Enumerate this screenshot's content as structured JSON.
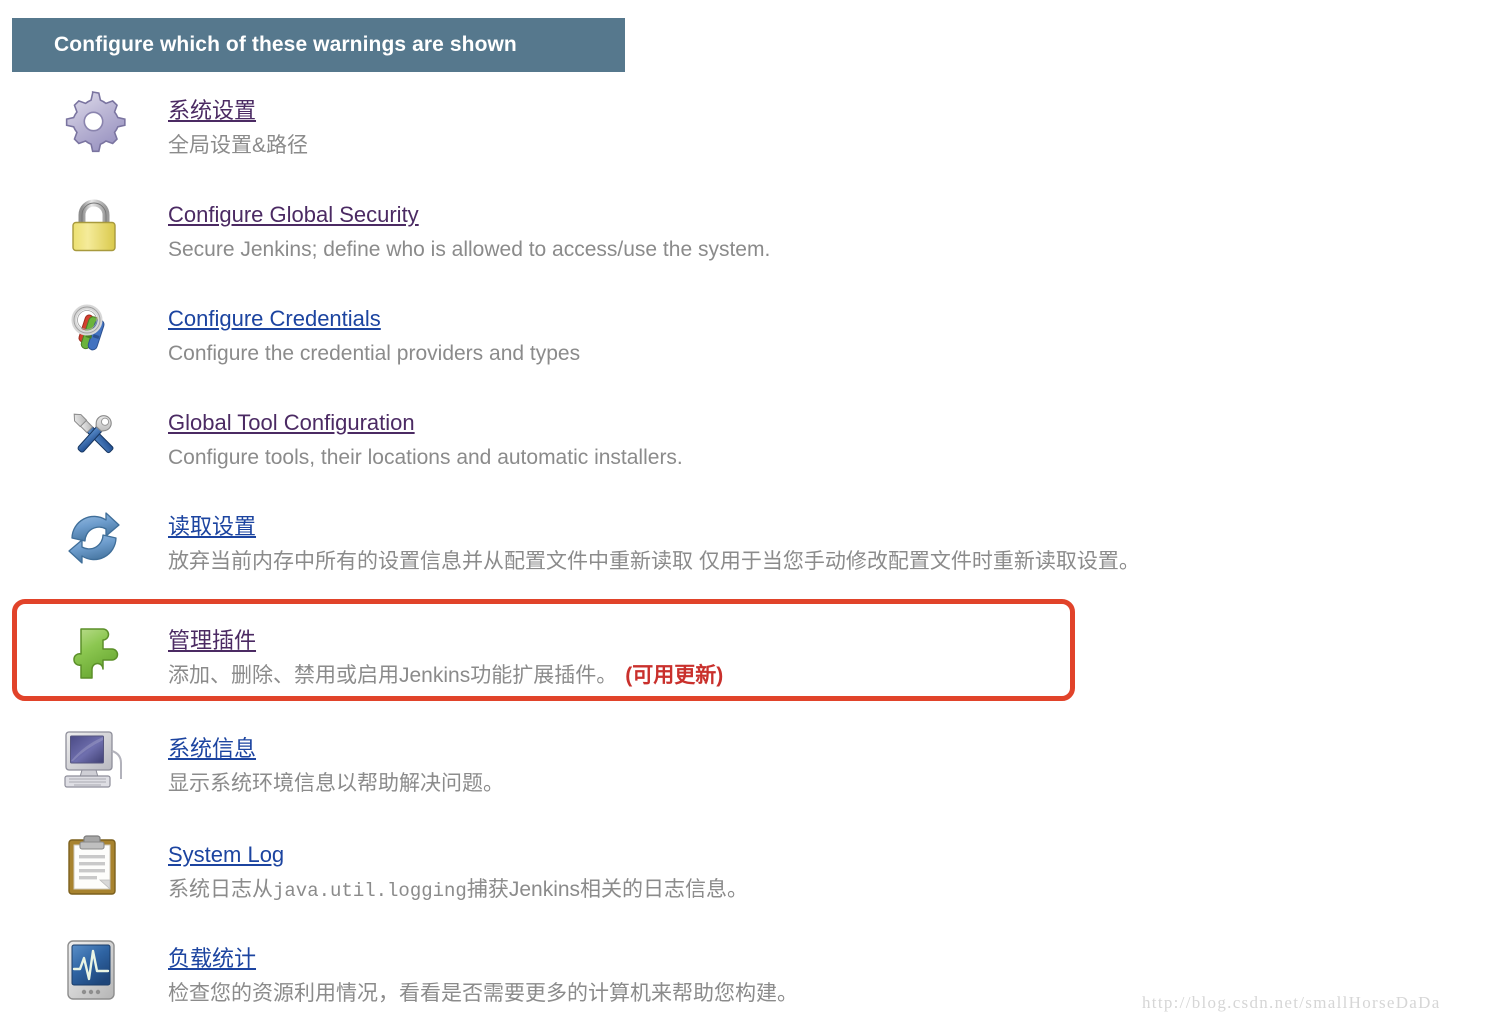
{
  "header": {
    "title": "Configure which of these warnings are shown",
    "bar_color": "#56788d",
    "text_color": "#ffffff"
  },
  "colors": {
    "visited_link": "#4b2a63",
    "unvisited_link": "#1c44a0",
    "description": "#8b8b8b",
    "highlight_border": "#e1432a",
    "update_badge": "#c9302c"
  },
  "items": [
    {
      "icon": "gear-icon",
      "label": "系统设置",
      "link_state": "visited",
      "description": "全局设置&路径",
      "badge": ""
    },
    {
      "icon": "padlock-icon",
      "label": "Configure Global Security",
      "link_state": "visited",
      "description": "Secure Jenkins; define who is allowed to access/use the system.",
      "badge": ""
    },
    {
      "icon": "keys-icon",
      "label": "Configure Credentials",
      "link_state": "unvisited",
      "description": "Configure the credential providers and types",
      "badge": ""
    },
    {
      "icon": "wrench-screwdriver-icon",
      "label": "Global Tool Configuration",
      "link_state": "visited",
      "description": "Configure tools, their locations and automatic installers.",
      "badge": ""
    },
    {
      "icon": "refresh-arrows-icon",
      "label": "读取设置",
      "link_state": "unvisited",
      "description": "放弃当前内存中所有的设置信息并从配置文件中重新读取 仅用于当您手动修改配置文件时重新读取设置。",
      "badge": ""
    },
    {
      "icon": "puzzle-piece-icon",
      "label": "管理插件",
      "link_state": "visited",
      "description": "添加、删除、禁用或启用Jenkins功能扩展插件。",
      "badge": "(可用更新)",
      "highlighted": true
    },
    {
      "icon": "computer-monitor-icon",
      "label": "系统信息",
      "link_state": "unvisited",
      "description": "显示系统环境信息以帮助解决问题。",
      "badge": ""
    },
    {
      "icon": "clipboard-icon",
      "label": "System Log",
      "link_state": "unvisited",
      "description_parts": [
        {
          "text": "系统日志从",
          "mono": false
        },
        {
          "text": "java.util.logging",
          "mono": true
        },
        {
          "text": "捕获Jenkins相关的日志信息。",
          "mono": false
        }
      ],
      "description": "系统日志从java.util.logging捕获Jenkins相关的日志信息。",
      "badge": ""
    },
    {
      "icon": "load-statistics-icon",
      "label": "负载统计",
      "link_state": "unvisited",
      "description": "检查您的资源利用情况，看看是否需要更多的计算机来帮助您构建。",
      "badge": ""
    }
  ],
  "watermark": {
    "text": "http://blog.csdn.net/smallHorseDaDa"
  }
}
